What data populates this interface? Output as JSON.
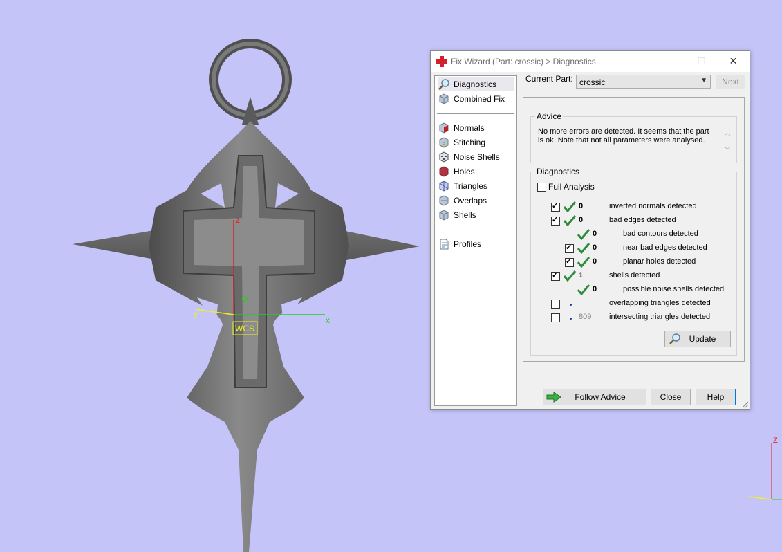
{
  "viewport": {
    "axis_labels": {
      "x": "x",
      "y": "y",
      "z": "z",
      "wcs": "WCS"
    },
    "corner_axis_label": "Z"
  },
  "dialog": {
    "title": "Fix Wizard (Part: crossic) > Diagnostics",
    "window_controls": {
      "minimize": "—",
      "maximize": "☐",
      "close": "✕"
    },
    "nav": {
      "items": [
        {
          "label": "Diagnostics",
          "icon": "magnifier-icon",
          "selected": true
        },
        {
          "label": "Combined Fix",
          "icon": "cube-icon"
        },
        {
          "label": "Normals",
          "icon": "normals-cube-icon"
        },
        {
          "label": "Stitching",
          "icon": "stitching-cube-icon"
        },
        {
          "label": "Noise Shells",
          "icon": "noise-shells-icon"
        },
        {
          "label": "Holes",
          "icon": "holes-cube-icon"
        },
        {
          "label": "Triangles",
          "icon": "triangles-cube-icon"
        },
        {
          "label": "Overlaps",
          "icon": "overlaps-cube-icon"
        },
        {
          "label": "Shells",
          "icon": "shells-cube-icon"
        },
        {
          "label": "Profiles",
          "icon": "profiles-icon"
        }
      ]
    },
    "current_part_label": "Current Part:",
    "current_part_value": "crossic",
    "next_label": "Next",
    "advice": {
      "title": "Advice",
      "text": "No more errors are detected. It seems that the part is ok. Note that not all parameters were analysed."
    },
    "diagnostics": {
      "title": "Diagnostics",
      "full_analysis_label": "Full Analysis",
      "full_analysis_checked": false,
      "rows": [
        {
          "checked": true,
          "status": "ok",
          "count": "0",
          "label": "inverted normals detected"
        },
        {
          "checked": true,
          "status": "ok",
          "count": "0",
          "label": "bad edges detected"
        },
        {
          "checked": null,
          "status": "ok",
          "count": "0",
          "label": "bad contours detected"
        },
        {
          "checked": true,
          "status": "ok",
          "count": "0",
          "label": "near bad edges detected"
        },
        {
          "checked": true,
          "status": "ok",
          "count": "0",
          "label": "planar holes detected"
        },
        {
          "checked": true,
          "status": "ok",
          "count": "1",
          "label": "shells detected"
        },
        {
          "checked": null,
          "status": "ok",
          "count": "0",
          "label": "possible noise shells detected"
        },
        {
          "checked": false,
          "status": "unknown",
          "count": "",
          "label": "overlapping triangles detected"
        },
        {
          "checked": false,
          "status": "unknown",
          "count": "809",
          "label": "intersecting triangles detected"
        }
      ],
      "update_label": "Update"
    },
    "buttons": {
      "follow_advice": "Follow Advice",
      "close": "Close",
      "help": "Help"
    },
    "colors": {
      "accent_border": "#0078d7",
      "ok_tick": "#2e8b3a",
      "title_icon": "#d4202a"
    }
  }
}
